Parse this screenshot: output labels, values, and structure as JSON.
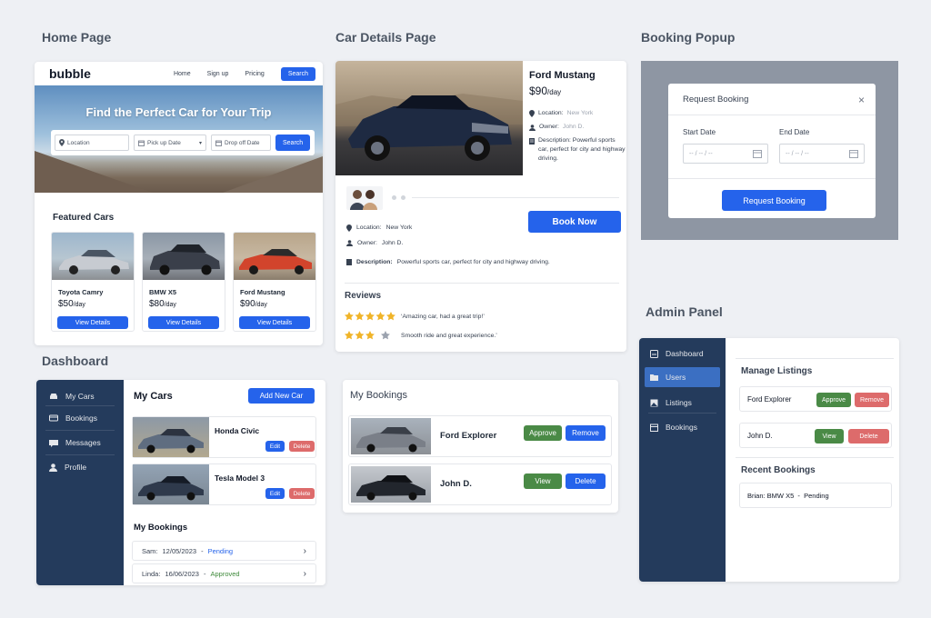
{
  "sections": {
    "home": "Home Page",
    "car_details": "Car Details Page",
    "booking_popup": "Booking Popup",
    "dashboard": "Dashboard",
    "admin": "Admin Panel"
  },
  "home": {
    "logo": "bubble",
    "nav": [
      "Home",
      "Sign up",
      "Pricing"
    ],
    "nav_search": "Search",
    "hero_title": "Find the Perfect Car for Your Trip",
    "search": {
      "location": "Location",
      "pickup": "Pick up Date",
      "dropoff": "Drop off Date",
      "button": "Search"
    },
    "featured_title": "Featured Cars",
    "cars": [
      {
        "name": "Toyota Camry",
        "price": "$50",
        "unit": "/day",
        "color": "#c7cbd1"
      },
      {
        "name": "BMW X5",
        "price": "$80",
        "unit": "/day",
        "color": "#3a3f4a"
      },
      {
        "name": "Ford Mustang",
        "price": "$90",
        "unit": "/day",
        "color": "#d2442c"
      }
    ],
    "view_label": "View Details"
  },
  "car_details": {
    "title": "Ford Mustang",
    "price": "$90",
    "unit": "/day",
    "location_label": "Location:",
    "location": "New York",
    "owner_label": "Owner:",
    "owner": "John D.",
    "description_label": "Description:",
    "description": "Powerful sports car, perfect for city and highway driving.",
    "book_now": "Book Now",
    "reviews_title": "Reviews",
    "reviews": [
      {
        "stars": 5,
        "text": "Amazing car, had a great trip!"
      },
      {
        "stars": 3,
        "text": "Smooth ride and great experience."
      }
    ]
  },
  "booking_popup": {
    "title": "Request Booking",
    "close": "×",
    "start_label": "Start Date",
    "end_label": "End Date",
    "date_placeholder": "-- / -- / --",
    "button": "Request Booking"
  },
  "dashboard": {
    "sidebar": [
      "My Cars",
      "Bookings",
      "Messages",
      "Profile"
    ],
    "my_cars_title": "My Cars",
    "add_button": "Add New Car",
    "cars": [
      {
        "name": "Honda Civic",
        "color": "#5f6d80"
      },
      {
        "name": "Tesla Model 3",
        "color": "#2f3a4c"
      }
    ],
    "edit": "Edit",
    "delete": "Delete",
    "my_bookings_title": "My Bookings",
    "bookings": [
      {
        "name": "Sam:",
        "date": "12/05/2023",
        "sep": "-",
        "status": "Pending",
        "status_color": "#2563eb"
      },
      {
        "name": "Linda:",
        "date": "16/06/2023",
        "sep": "-",
        "status": "Approved",
        "status_color": "#3f8a3b"
      }
    ]
  },
  "my_bookings": {
    "title": "My Bookings",
    "rows": [
      {
        "name": "Ford Explorer",
        "b1": "Approve",
        "b2": "Remove",
        "color": "#7a7f88"
      },
      {
        "name": "John D.",
        "b1": "View",
        "b2": "Delete",
        "color": "#22262d"
      }
    ]
  },
  "admin": {
    "sidebar": [
      "Dashboard",
      "Users",
      "Listings",
      "Bookings"
    ],
    "active": "Users",
    "manage_title": "Manage Listings",
    "listings": [
      {
        "name": "Ford Explorer",
        "b1": "Approve",
        "b2": "Remove"
      },
      {
        "name": "John D.",
        "b1": "View",
        "b2": "Delete"
      }
    ],
    "recent_title": "Recent Bookings",
    "recent": "Brian: BMW X5  -  Pending"
  }
}
